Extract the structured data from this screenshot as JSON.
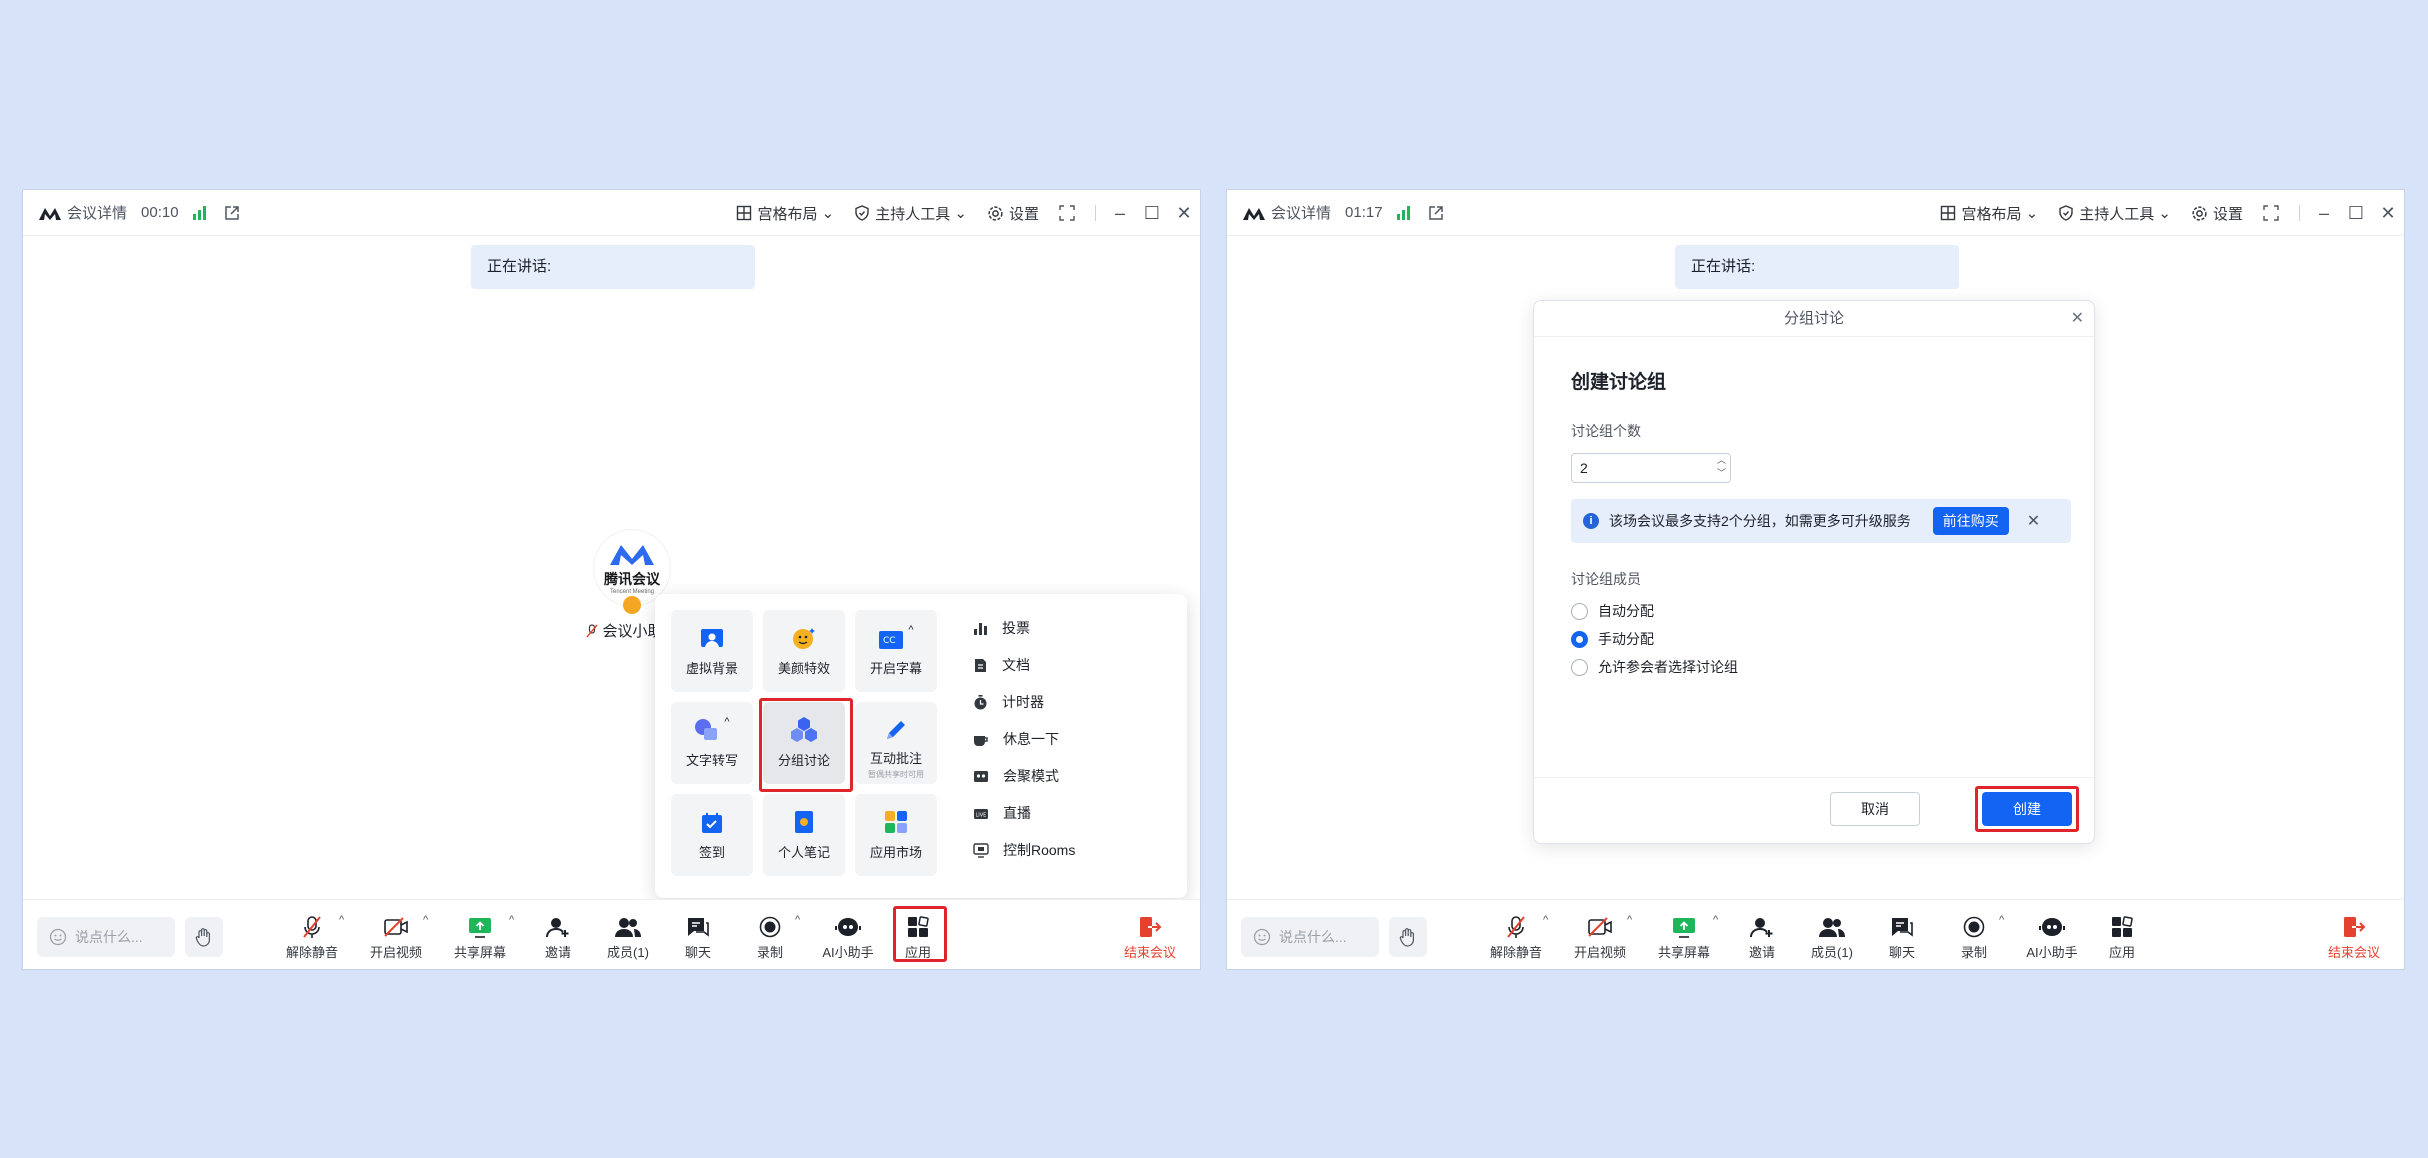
{
  "left_window": {
    "titlebar": {
      "meeting_detail": "会议详情",
      "timer": "00:10",
      "layout": "宫格布局",
      "host_tools": "主持人工具",
      "settings": "设置"
    },
    "speaking_label": "正在讲话:",
    "participant": {
      "brand": "腾讯会议",
      "brand_sub": "Tencent Meeting",
      "name": "会议小助手"
    },
    "apps_popup": {
      "tiles": [
        {
          "label": "虚拟背景",
          "icon": "virtual-background-icon"
        },
        {
          "label": "美颜特效",
          "icon": "beauty-icon"
        },
        {
          "label": "开启字幕",
          "icon": "subtitles-icon"
        },
        {
          "label": "文字转写",
          "icon": "transcription-icon"
        },
        {
          "label": "分组讨论",
          "icon": "breakout-rooms-icon"
        },
        {
          "label": "互动批注",
          "sub": "暂偶共享时可用",
          "icon": "annotation-icon"
        },
        {
          "label": "签到",
          "icon": "check-in-icon"
        },
        {
          "label": "个人笔记",
          "icon": "notes-icon"
        },
        {
          "label": "应用市场",
          "icon": "app-market-icon"
        }
      ],
      "list": [
        {
          "label": "投票",
          "icon": "vote-icon"
        },
        {
          "label": "文档",
          "icon": "document-icon"
        },
        {
          "label": "计时器",
          "icon": "timer-icon"
        },
        {
          "label": "休息一下",
          "icon": "coffee-icon"
        },
        {
          "label": "会聚模式",
          "icon": "together-mode-icon"
        },
        {
          "label": "直播",
          "icon": "live-icon"
        },
        {
          "label": "控制Rooms",
          "icon": "rooms-icon"
        }
      ]
    }
  },
  "right_window": {
    "titlebar": {
      "meeting_detail": "会议详情",
      "timer": "01:17",
      "layout": "宫格布局",
      "host_tools": "主持人工具",
      "settings": "设置"
    },
    "speaking_label": "正在讲话:",
    "dialog": {
      "header": "分组讨论",
      "title": "创建讨论组",
      "count_label": "讨论组个数",
      "count_value": "2",
      "notice": "该场会议最多支持2个分组，如需更多可升级服务",
      "buy_button": "前往购买",
      "members_label": "讨论组成员",
      "options": [
        {
          "label": "自动分配",
          "checked": false
        },
        {
          "label": "手动分配",
          "checked": true
        },
        {
          "label": "允许参会者选择讨论组",
          "checked": false
        }
      ],
      "cancel": "取消",
      "create": "创建"
    }
  },
  "bottombar": {
    "say_placeholder": "说点什么...",
    "tools": [
      {
        "label": "解除静音",
        "icon": "mic-muted-icon"
      },
      {
        "label": "开启视频",
        "icon": "video-off-icon"
      },
      {
        "label": "共享屏幕",
        "icon": "share-screen-icon"
      },
      {
        "label": "邀请",
        "icon": "invite-icon"
      },
      {
        "label": "成员(1)",
        "icon": "members-icon"
      },
      {
        "label": "聊天",
        "icon": "chat-icon"
      },
      {
        "label": "录制",
        "icon": "record-icon"
      },
      {
        "label": "AI小助手",
        "icon": "ai-assistant-icon"
      },
      {
        "label": "应用",
        "icon": "apps-icon"
      }
    ],
    "end_meeting": "结束会议"
  },
  "colors": {
    "background": "#d7e3f9",
    "primary": "#1464f4",
    "highlight": "#e0242c",
    "end": "#e5412f",
    "signal": "#1fb55b"
  }
}
